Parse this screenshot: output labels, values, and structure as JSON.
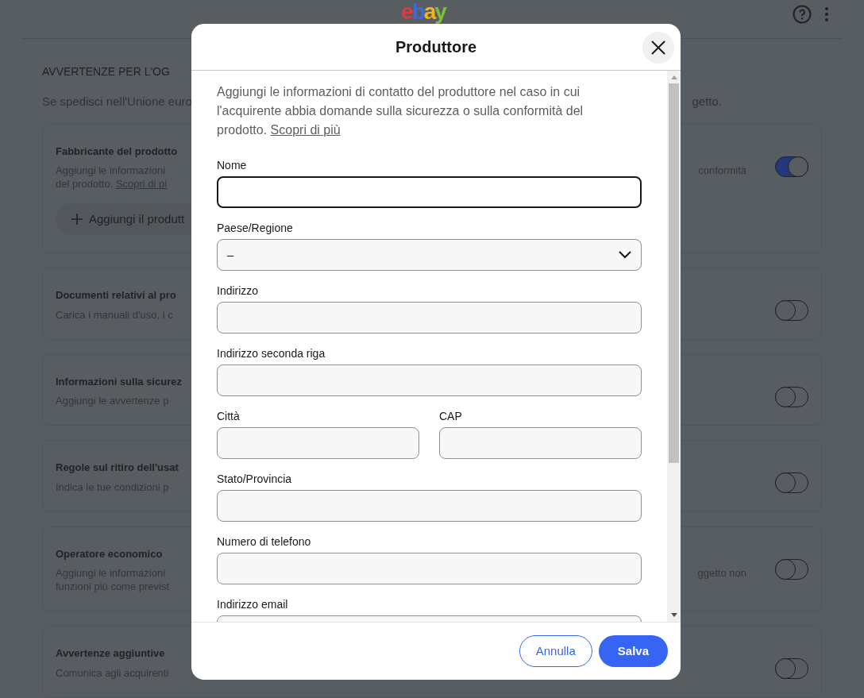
{
  "header": {
    "logo": "ebay"
  },
  "section": {
    "title": "AVVERTENZE PER L'OG",
    "subtitle_left": "Se spedisci nell'Unione euro",
    "subtitle_right": "getto."
  },
  "cards": [
    {
      "title": "Fabbricante del prodotto",
      "lines": [
        {
          "left": "Aggiungi le informazioni",
          "right": "conformità"
        },
        {
          "left": "del prodotto.",
          "link": "Scopri di pi"
        }
      ],
      "button": "Aggiungi il produtt",
      "on": true
    },
    {
      "title": "Documenti relativi al pro",
      "lines": [
        {
          "left": "Carica i manuali d'uso, i c"
        }
      ],
      "on": false
    },
    {
      "title": "Informazioni sulla sicurez",
      "lines": [
        {
          "left": "Aggiungi le avvertenze p"
        }
      ],
      "on": false
    },
    {
      "title": "Regole sul ritiro dell'usat",
      "lines": [
        {
          "left": "Indica le tue condizioni p"
        }
      ],
      "on": false
    },
    {
      "title": "Operatore economico",
      "lines": [
        {
          "left": "Aggiungi le informazioni",
          "right": "ggetto non"
        },
        {
          "left": "funzioni più come previst"
        }
      ],
      "on": false
    },
    {
      "title": "Avvertenze aggiuntive",
      "lines": [
        {
          "left": "Comunica agli acquirenti"
        }
      ],
      "on": false
    }
  ],
  "dialog": {
    "title": "Produttore",
    "intro": "Aggiungi le informazioni di contatto del produttore nel caso in cui l'acquirente abbia domande sulla sicurezza o sulla conformità del prodotto.",
    "intro_link": "Scopri di più",
    "fields": [
      {
        "kind": "text",
        "label": "Nome",
        "focused": true
      },
      {
        "kind": "select",
        "label": "Paese/Regione",
        "value": "–",
        "focused": false
      },
      {
        "kind": "text",
        "label": "Indirizzo",
        "focused": false
      },
      {
        "kind": "text",
        "label": "Indirizzo seconda riga",
        "focused": false
      },
      {
        "kind": "row",
        "fields": [
          {
            "kind": "text",
            "label": "Città",
            "focused": false
          },
          {
            "kind": "text",
            "label": "CAP",
            "focused": false
          }
        ]
      },
      {
        "kind": "text",
        "label": "Stato/Provincia",
        "focused": false
      },
      {
        "kind": "text",
        "label": "Numero di telefono",
        "focused": false
      },
      {
        "kind": "text",
        "label": "Indirizzo email",
        "focused": false
      }
    ],
    "buttons": [
      {
        "kind": "secondary",
        "label": "Annulla"
      },
      {
        "kind": "primary",
        "label": "Salva"
      }
    ]
  }
}
